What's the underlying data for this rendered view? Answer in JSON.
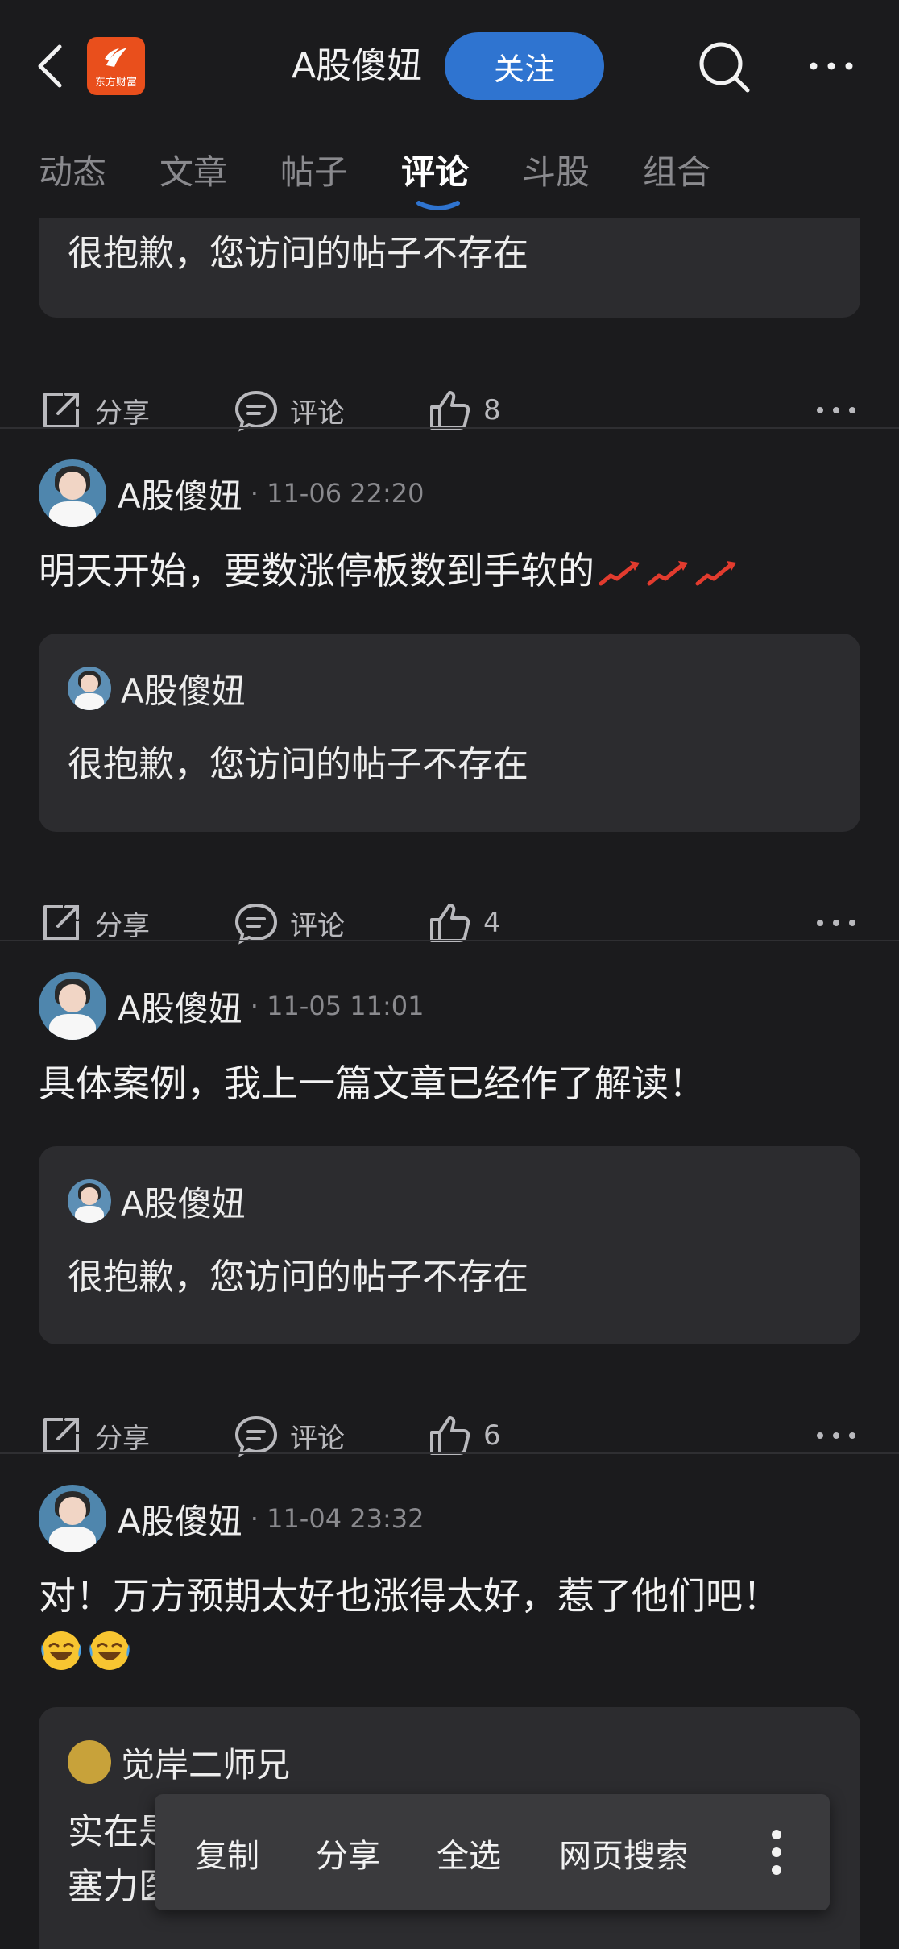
{
  "header": {
    "brand_logo_text": "东方财富",
    "title": "A股傻妞",
    "follow_label": "关注"
  },
  "tabs": [
    {
      "label": "动态"
    },
    {
      "label": "文章"
    },
    {
      "label": "帖子"
    },
    {
      "label": "评论",
      "active": true
    },
    {
      "label": "斗股"
    },
    {
      "label": "组合"
    }
  ],
  "partial": {
    "quote_text": "很抱歉，您访问的帖子不存在",
    "share": "分享",
    "comment": "评论",
    "likes": "8"
  },
  "posts": [
    {
      "author": "A股傻妞",
      "date": "· 11-06 22:20",
      "text": "明天开始，要数涨停板数到手软的",
      "quote_author": "A股傻妞",
      "quote_text": "很抱歉，您访问的帖子不存在",
      "share": "分享",
      "comment": "评论",
      "likes": "4"
    },
    {
      "author": "A股傻妞",
      "date": "· 11-05 11:01",
      "text": "具体案例，我上一篇文章已经作了解读！",
      "quote_author": "A股傻妞",
      "quote_text": "很抱歉，您访问的帖子不存在",
      "share": "分享",
      "comment": "评论",
      "likes": "6"
    },
    {
      "author": "A股傻妞",
      "date": "· 11-04 23:32",
      "text": "对！万方预期太好也涨得太好，惹了他们吧！",
      "quote_author": "觉岸二师兄",
      "quote_line1": "实在是",
      "quote_line2": "塞力医"
    }
  ],
  "context_menu": [
    "复制",
    "分享",
    "全选",
    "网页搜索"
  ]
}
